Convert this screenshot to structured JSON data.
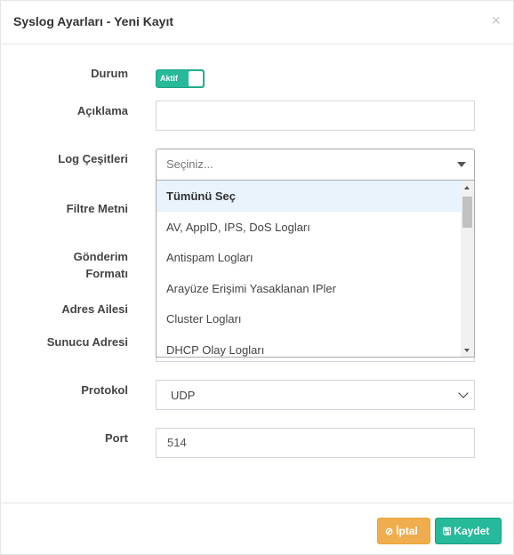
{
  "modal": {
    "title": "Syslog Ayarları - Yeni Kayıt",
    "close_glyph": "×"
  },
  "fields": {
    "status": {
      "label": "Durum",
      "toggle_text": "Aktif",
      "value": "on"
    },
    "description": {
      "label": "Açıklama",
      "value": ""
    },
    "log_types": {
      "label": "Log Çeşitleri",
      "placeholder": "Seçiniz..."
    },
    "filter_text": {
      "label": "Filtre Metni"
    },
    "send_format": {
      "label_line1": "Gönderim",
      "label_line2": "Formatı"
    },
    "address_family": {
      "label": "Adres Ailesi"
    },
    "server_address": {
      "label": "Sunucu Adresi"
    },
    "protocol": {
      "label": "Protokol",
      "value": "UDP"
    },
    "port": {
      "label": "Port",
      "value": "514"
    }
  },
  "dropdown": {
    "items": [
      {
        "label": "Tümünü Seç"
      },
      {
        "label": "AV, AppID, IPS, DoS Logları"
      },
      {
        "label": "Antispam Logları"
      },
      {
        "label": "Arayüze Erişimi Yasaklanan IPler"
      },
      {
        "label": "Cluster Logları"
      },
      {
        "label": "DHCP Olay Logları"
      }
    ]
  },
  "footer": {
    "cancel_label": "İptal",
    "save_label": "Kaydet",
    "cancel_icon": "ban-icon",
    "save_icon": "floppy-disk-icon"
  },
  "colors": {
    "accent": "#26b99a",
    "warning": "#f0ad4e"
  }
}
